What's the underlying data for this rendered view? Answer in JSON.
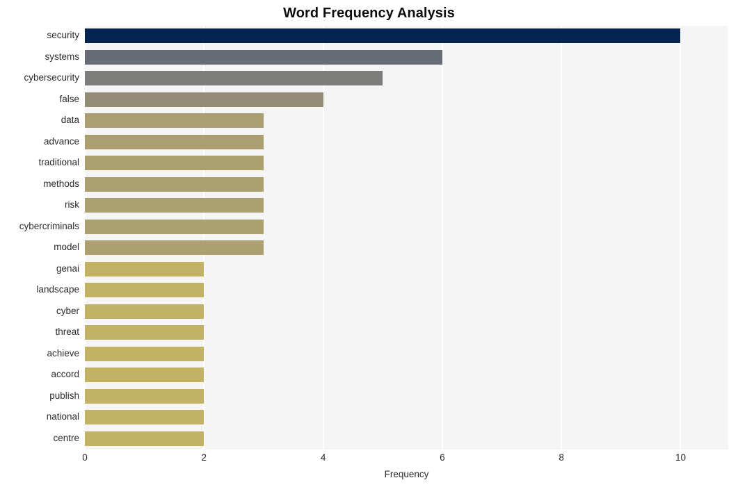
{
  "chart_data": {
    "type": "bar",
    "orientation": "horizontal",
    "title": "Word Frequency Analysis",
    "xlabel": "Frequency",
    "ylabel": "",
    "xlim": [
      0,
      10.8
    ],
    "ylim": null,
    "grid": true,
    "legend": null,
    "xticks": [
      "0",
      "2",
      "4",
      "6",
      "8",
      "10"
    ],
    "xtick_values": [
      0,
      2,
      4,
      6,
      8,
      10
    ],
    "categories": [
      "security",
      "systems",
      "cybersecurity",
      "false",
      "data",
      "advance",
      "traditional",
      "methods",
      "risk",
      "cybercriminals",
      "model",
      "genai",
      "landscape",
      "cyber",
      "threat",
      "achieve",
      "accord",
      "publish",
      "national",
      "centre"
    ],
    "values": [
      10,
      6,
      5,
      4,
      3,
      3,
      3,
      3,
      3,
      3,
      3,
      2,
      2,
      2,
      2,
      2,
      2,
      2,
      2,
      2
    ],
    "bar_colors": [
      "#042452",
      "#666b76",
      "#7d7d7b",
      "#938d78",
      "#ab9f71",
      "#ab9f71",
      "#aba070",
      "#aba070",
      "#aba070",
      "#aba070",
      "#aca070",
      "#c2b263",
      "#c2b263",
      "#c2b263",
      "#c2b263",
      "#c2b263",
      "#c2b263",
      "#c2b263",
      "#c2b263",
      "#c2b263"
    ],
    "plot_background": "#f5f5f5",
    "gridline_color": "#ffffff",
    "text_color": "#2b2b2b",
    "title_color": "#0d0d0d",
    "page_background": "#ffffff"
  }
}
